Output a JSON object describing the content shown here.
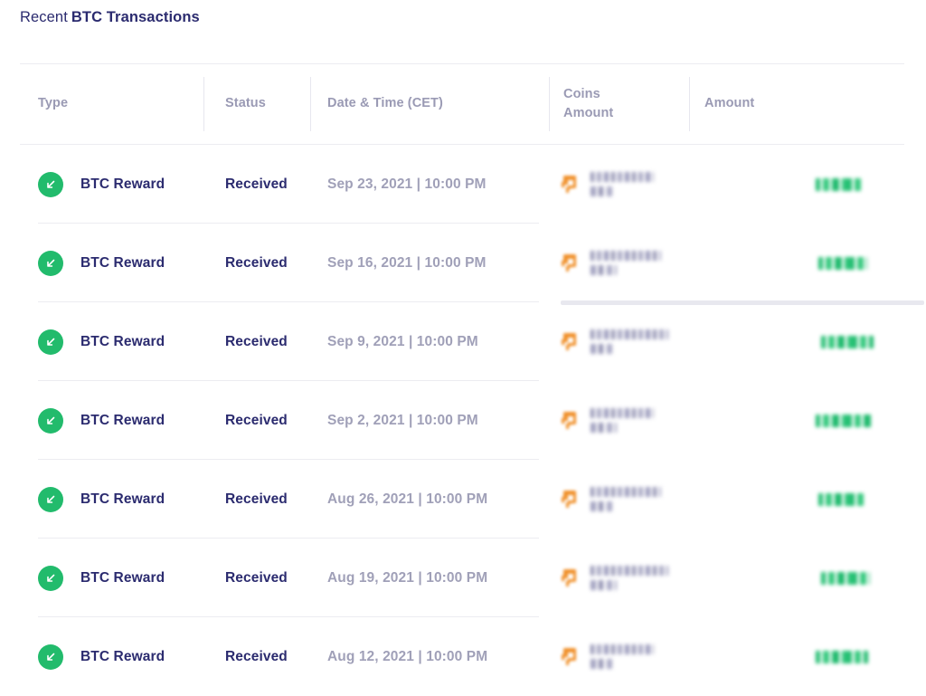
{
  "panel": {
    "title_light": "Recent",
    "title_bold": "BTC Transactions"
  },
  "table": {
    "columns": [
      {
        "key": "type",
        "label": "Type"
      },
      {
        "key": "status",
        "label": "Status"
      },
      {
        "key": "date",
        "label": "Date & Time (CET)"
      },
      {
        "key": "coins",
        "label": "Coins\nAmount"
      },
      {
        "key": "amount",
        "label": "Amount"
      }
    ],
    "rows": [
      {
        "type_icon": "arrow-down-left-icon",
        "type": "BTC Reward",
        "status": "Received",
        "date": "Sep 23, 2021 | 10:00 PM",
        "coin_icon": "bitcoin-icon",
        "coins_amount": "",
        "coins_amount_redacted": true,
        "amount": "",
        "amount_redacted": true
      },
      {
        "type_icon": "arrow-down-left-icon",
        "type": "BTC Reward",
        "status": "Received",
        "date": "Sep 16, 2021 | 10:00 PM",
        "coin_icon": "bitcoin-icon",
        "coins_amount": "",
        "coins_amount_redacted": true,
        "amount": "",
        "amount_redacted": true
      },
      {
        "type_icon": "arrow-down-left-icon",
        "type": "BTC Reward",
        "status": "Received",
        "date": "Sep 9, 2021 | 10:00 PM",
        "coin_icon": "bitcoin-icon",
        "coins_amount": "",
        "coins_amount_redacted": true,
        "amount": "",
        "amount_redacted": true
      },
      {
        "type_icon": "arrow-down-left-icon",
        "type": "BTC Reward",
        "status": "Received",
        "date": "Sep 2, 2021 | 10:00 PM",
        "coin_icon": "bitcoin-icon",
        "coins_amount": "",
        "coins_amount_redacted": true,
        "amount": "",
        "amount_redacted": true
      },
      {
        "type_icon": "arrow-down-left-icon",
        "type": "BTC Reward",
        "status": "Received",
        "date": "Aug 26, 2021 | 10:00 PM",
        "coin_icon": "bitcoin-icon",
        "coins_amount": "",
        "coins_amount_redacted": true,
        "amount": "",
        "amount_redacted": true
      },
      {
        "type_icon": "arrow-down-left-icon",
        "type": "BTC Reward",
        "status": "Received",
        "date": "Aug 19, 2021 | 10:00 PM",
        "coin_icon": "bitcoin-icon",
        "coins_amount": "",
        "coins_amount_redacted": true,
        "amount": "",
        "amount_redacted": true
      },
      {
        "type_icon": "arrow-down-left-icon",
        "type": "BTC Reward",
        "status": "Received",
        "date": "Aug 12, 2021 | 10:00 PM",
        "coin_icon": "bitcoin-icon",
        "coins_amount": "",
        "coins_amount_redacted": true,
        "amount": "",
        "amount_redacted": true
      }
    ]
  },
  "colors": {
    "title_navy": "#2b2b6f",
    "header_gray": "#9a9ab4",
    "date_gray": "#a0a0b8",
    "received_green": "#22bb6c",
    "bitcoin_orange": "#f0902a",
    "divider": "#ececf1",
    "background": "#ffffff"
  }
}
